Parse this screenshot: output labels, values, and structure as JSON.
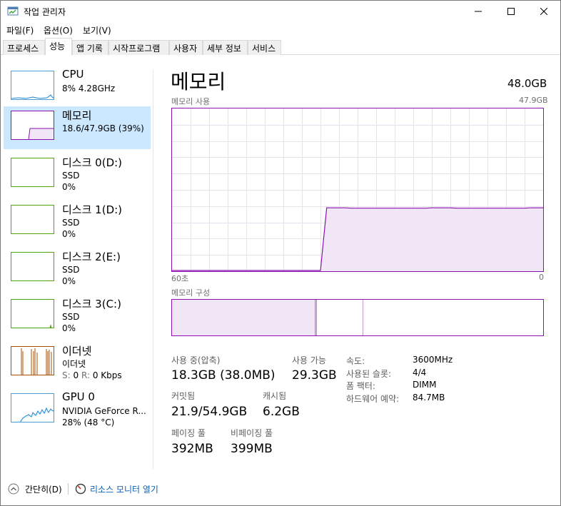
{
  "window": {
    "title": "작업 관리자"
  },
  "menu": [
    "파일(F)",
    "옵션(O)",
    "보기(V)"
  ],
  "tabs": [
    "프로세스",
    "성능",
    "앱 기록",
    "시작프로그램",
    "사용자",
    "세부 정보",
    "서비스"
  ],
  "active_tab": "성능",
  "sidebar": [
    {
      "name": "CPU",
      "sub1": "8% 4.28GHz"
    },
    {
      "name": "메모리",
      "sub1": "18.6/47.9GB (39%)"
    },
    {
      "name": "디스크 0(D:)",
      "sub1": "SSD",
      "sub2": "0%"
    },
    {
      "name": "디스크 1(D:)",
      "sub1": "SSD",
      "sub2": "0%"
    },
    {
      "name": "디스크 2(E:)",
      "sub1": "SSD",
      "sub2": "0%"
    },
    {
      "name": "디스크 3(C:)",
      "sub1": "SSD",
      "sub2": "0%"
    },
    {
      "name": "이더넷",
      "sub1": "이더넷",
      "sub2_label_s": "S:",
      "sub2_s": "0",
      "sub2_label_r": "R:",
      "sub2_r": "0 Kbps"
    },
    {
      "name": "GPU 0",
      "sub1": "NVIDIA GeForce R...",
      "sub2": "28% (48 °C)"
    }
  ],
  "main": {
    "title": "메모리",
    "total": "48.0GB",
    "usage_label": "메모리 사용",
    "usage_max": "47.9GB",
    "axis_left": "60초",
    "axis_right": "0",
    "composition_label": "메모리 구성",
    "stats": {
      "in_use_label": "사용 중(압축)",
      "in_use": "18.3GB (38.0MB)",
      "available_label": "사용 가능",
      "available": "29.3GB",
      "committed_label": "커밋됨",
      "committed": "21.9/54.9GB",
      "cached_label": "캐시됨",
      "cached": "6.2GB",
      "paged_label": "페이징 풀",
      "paged": "392MB",
      "nonpaged_label": "비페이징 풀",
      "nonpaged": "399MB"
    },
    "details": [
      {
        "k": "속도:",
        "v": "3600MHz"
      },
      {
        "k": "사용된 슬롯:",
        "v": "4/4"
      },
      {
        "k": "폼 팩터:",
        "v": "DIMM"
      },
      {
        "k": "하드웨어 예약:",
        "v": "84.7MB"
      }
    ]
  },
  "footer": {
    "fewer_details": "간단히(D)",
    "resource_monitor": "리소스 모니터 열기"
  },
  "colors": {
    "memory": "#8b12ae",
    "cpu": "#1f86d3",
    "disk": "#4da60c",
    "ethernet": "#a74f01",
    "gpu": "#1f86d3",
    "selected": "#cce8ff"
  },
  "chart_data": {
    "type": "area",
    "title": "메모리 사용",
    "x": [
      60,
      59,
      58,
      57,
      56,
      55,
      54,
      53,
      52,
      51,
      50,
      49,
      48,
      47,
      46,
      45,
      44,
      43,
      42,
      41,
      40,
      39,
      38,
      37,
      36,
      35,
      34,
      33,
      32,
      31,
      30,
      29,
      28,
      27,
      26,
      25,
      24,
      23,
      22,
      21,
      20,
      19,
      18,
      17,
      16,
      15,
      14,
      13,
      12,
      11,
      10,
      9,
      8,
      7,
      6,
      5,
      4,
      3,
      2,
      1,
      0
    ],
    "values": [
      0,
      0,
      0,
      0,
      0,
      0,
      0,
      0,
      0,
      0,
      0,
      0,
      0,
      0,
      0,
      0,
      0,
      0,
      0,
      0,
      0,
      0,
      0,
      0,
      0,
      18.6,
      18.6,
      18.6,
      18.6,
      18.5,
      18.5,
      18.5,
      18.5,
      18.5,
      18.5,
      18.5,
      18.5,
      18.5,
      18.5,
      18.5,
      18.5,
      18.5,
      18.6,
      18.6,
      18.6,
      18.6,
      18.5,
      18.5,
      18.5,
      18.5,
      18.5,
      18.5,
      18.5,
      18.5,
      18.5,
      18.5,
      18.5,
      18.5,
      18.6,
      18.6,
      18.6
    ],
    "ylim": [
      0,
      47.9
    ]
  }
}
